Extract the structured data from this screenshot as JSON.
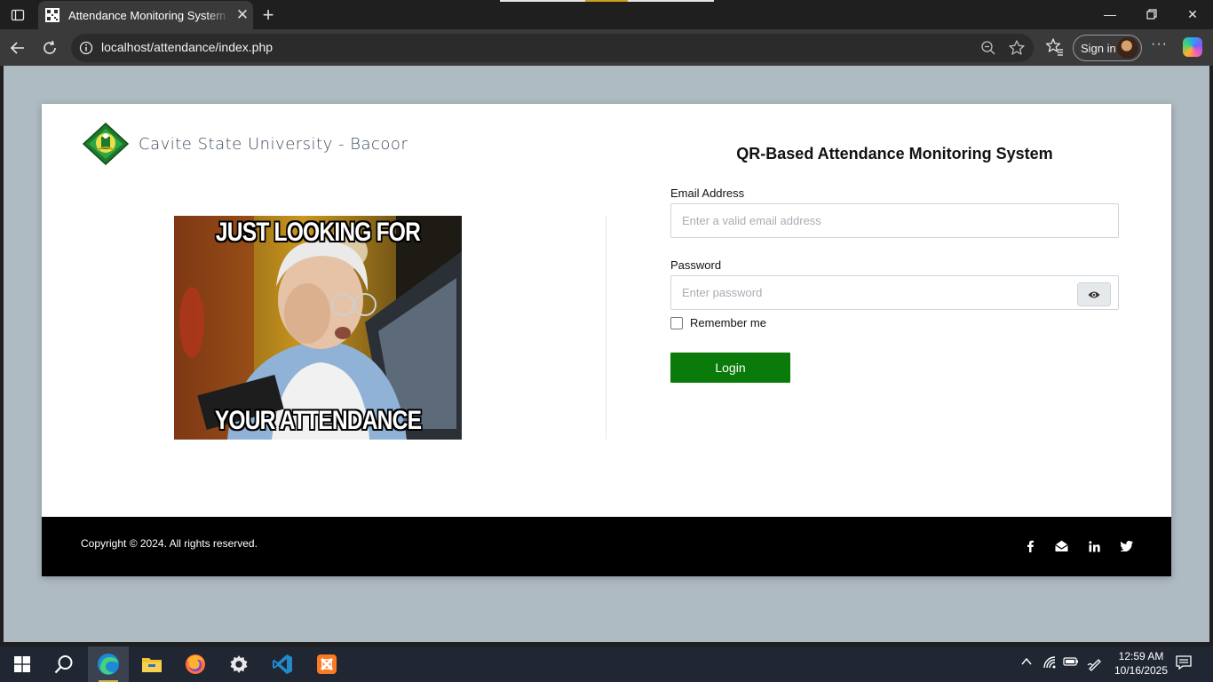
{
  "browser": {
    "tab_title": "Attendance Monitoring System u",
    "url": "localhost/attendance/index.php",
    "signin_label": "Sign in",
    "icons": [
      "tab-actions-icon",
      "back-arrow-icon",
      "refresh-icon",
      "site-info-icon",
      "zoom-out-icon",
      "star-icon",
      "favorites-icon",
      "more-icon",
      "copilot-icon"
    ]
  },
  "page": {
    "brand_name": "Cavite State University - Bacoor",
    "meme": {
      "top_text": "JUST LOOKING FOR",
      "bottom_text": "YOUR ATTENDANCE"
    },
    "form": {
      "title": "QR-Based Attendance Monitoring System",
      "email_label": "Email Address",
      "email_placeholder": "Enter a valid email address",
      "email_value": "",
      "password_label": "Password",
      "password_placeholder": "Enter password",
      "password_value": "",
      "remember_label": "Remember me",
      "remember_checked": false,
      "login_label": "Login"
    },
    "footer": {
      "copyright": "Copyright © 2024. All rights reserved.",
      "social": [
        "facebook-icon",
        "envelope-icon",
        "linkedin-icon",
        "twitter-icon"
      ]
    }
  },
  "taskbar": {
    "apps": [
      "start-icon",
      "search-icon",
      "edge-icon",
      "file-explorer-icon",
      "firefox-icon",
      "settings-icon",
      "vscode-icon",
      "xampp-icon"
    ],
    "time": "12:59 AM",
    "date": "10/16/2025"
  },
  "colors": {
    "page_background": "#aebbc3",
    "login_button": "#0a7a0a",
    "footer": "#000000",
    "brand_text": "#3b4a5a"
  }
}
